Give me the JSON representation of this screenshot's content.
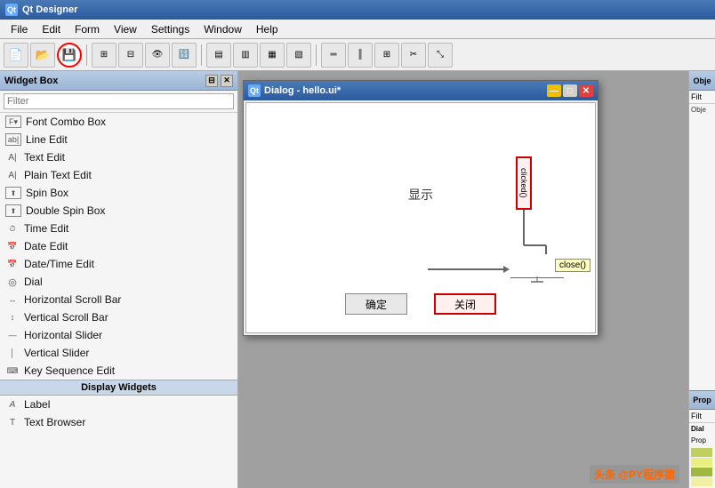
{
  "app": {
    "title": "Qt Designer",
    "icon": "Qt"
  },
  "menu": {
    "items": [
      "File",
      "Edit",
      "Form",
      "View",
      "Settings",
      "Window",
      "Help"
    ]
  },
  "toolbar": {
    "buttons": [
      {
        "name": "new",
        "icon": "📄"
      },
      {
        "name": "open",
        "icon": "📁"
      },
      {
        "name": "save",
        "icon": "💾",
        "highlighted": true
      },
      {
        "name": "sep1",
        "sep": true
      },
      {
        "name": "grid",
        "icon": "⊞"
      },
      {
        "name": "preview",
        "icon": "👁"
      },
      {
        "name": "sep2",
        "sep": true
      },
      {
        "name": "align-left",
        "icon": "⬛"
      },
      {
        "name": "align-right",
        "icon": "⬛"
      },
      {
        "name": "sep3",
        "sep": true
      },
      {
        "name": "connect",
        "icon": "⊞"
      },
      {
        "name": "buddy",
        "icon": "⊞"
      },
      {
        "name": "tab-order",
        "icon": "⊞"
      },
      {
        "name": "sep4",
        "sep": true
      },
      {
        "name": "break-layout",
        "icon": "⊞"
      },
      {
        "name": "adjust-size",
        "icon": "⊞"
      }
    ]
  },
  "widget_box": {
    "title": "Widget Box",
    "filter_placeholder": "Filter",
    "items": [
      {
        "label": "Font Combo Box",
        "icon": "F",
        "type": "widget"
      },
      {
        "label": "Line Edit",
        "icon": "ab|",
        "type": "widget"
      },
      {
        "label": "Text Edit",
        "icon": "A|",
        "type": "widget"
      },
      {
        "label": "Plain Text Edit",
        "icon": "A|",
        "type": "widget"
      },
      {
        "label": "Spin Box",
        "icon": "⬆",
        "type": "widget"
      },
      {
        "label": "Double Spin Box",
        "icon": "⬆",
        "type": "widget"
      },
      {
        "label": "Time Edit",
        "icon": "⏱",
        "type": "widget"
      },
      {
        "label": "Date Edit",
        "icon": "📅",
        "type": "widget"
      },
      {
        "label": "Date/Time Edit",
        "icon": "📅",
        "type": "widget"
      },
      {
        "label": "Dial",
        "icon": "◎",
        "type": "widget"
      },
      {
        "label": "Horizontal Scroll Bar",
        "icon": "↔",
        "type": "widget"
      },
      {
        "label": "Vertical Scroll Bar",
        "icon": "↕",
        "type": "widget"
      },
      {
        "label": "Horizontal Slider",
        "icon": "—",
        "type": "widget"
      },
      {
        "label": "Vertical Slider",
        "icon": "│",
        "type": "widget"
      },
      {
        "label": "Key Sequence Edit",
        "icon": "⌨",
        "type": "widget"
      },
      {
        "label": "Display Widgets",
        "type": "category"
      },
      {
        "label": "Label",
        "icon": "A",
        "type": "widget"
      },
      {
        "label": "Text Browser",
        "icon": "T",
        "type": "widget"
      }
    ]
  },
  "dialog": {
    "title": "Dialog - hello.ui*",
    "icon": "Qt",
    "display_text": "显示",
    "confirm_btn": "确定",
    "close_btn": "关闭",
    "signal_label": "clicked()",
    "slot_label": "close()"
  },
  "right_panel": {
    "sections": [
      "Obje",
      "Prop"
    ],
    "object_label": "Obje",
    "filter_label": "Filt",
    "object_section": "Obje",
    "property_section": "Prop",
    "dial_label": "Dial",
    "prop2_label": "Prop",
    "colors": [
      "#c0d060",
      "#e8f080",
      "#a0b840",
      "#f0f0a0"
    ]
  },
  "watermark": "头条 @PY程序猿"
}
